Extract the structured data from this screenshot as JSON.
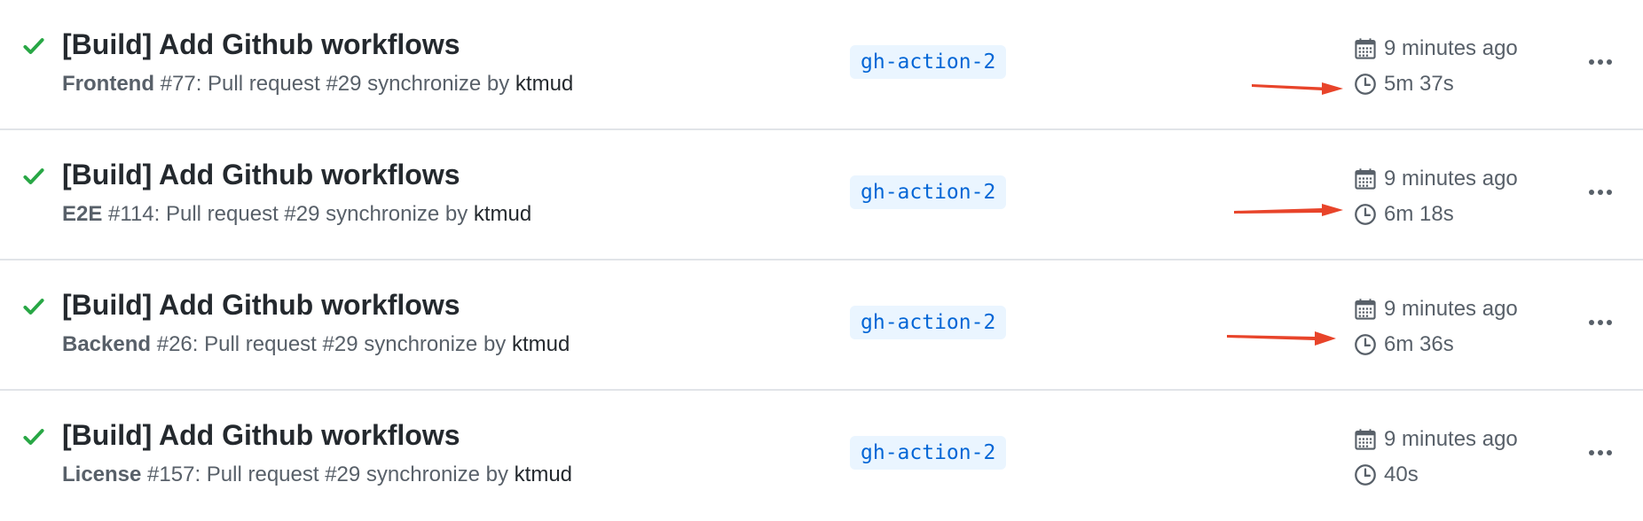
{
  "runs": [
    {
      "title": "[Build] Add Github workflows",
      "workflow": "Frontend",
      "run_number": " #77",
      "event": ": Pull request #29 synchronize by ",
      "actor": "ktmud",
      "branch": "gh-action-2",
      "started": "9 minutes ago",
      "duration": "5m 37s",
      "highlighted": true
    },
    {
      "title": "[Build] Add Github workflows",
      "workflow": "E2E",
      "run_number": " #114",
      "event": ": Pull request #29 synchronize by ",
      "actor": "ktmud",
      "branch": "gh-action-2",
      "started": "9 minutes ago",
      "duration": "6m 18s",
      "highlighted": true
    },
    {
      "title": "[Build] Add Github workflows",
      "workflow": "Backend",
      "run_number": " #26",
      "event": ": Pull request #29 synchronize by ",
      "actor": "ktmud",
      "branch": "gh-action-2",
      "started": "9 minutes ago",
      "duration": "6m 36s",
      "highlighted": true
    },
    {
      "title": "[Build] Add Github workflows",
      "workflow": "License",
      "run_number": " #157",
      "event": ": Pull request #29 synchronize by ",
      "actor": "ktmud",
      "branch": "gh-action-2",
      "started": "9 minutes ago",
      "duration": "40s",
      "highlighted": false
    }
  ],
  "icons": {
    "status": "check-icon",
    "started": "calendar-icon",
    "duration": "clock-icon",
    "menu": "kebab-horizontal-icon",
    "annotation": "red-arrow-annotation"
  },
  "colors": {
    "success": "#28a745",
    "branch_bg": "#eaf5ff",
    "branch_text": "#0366d6",
    "annotation": "#e8442a",
    "divider": "#e1e4e8"
  }
}
